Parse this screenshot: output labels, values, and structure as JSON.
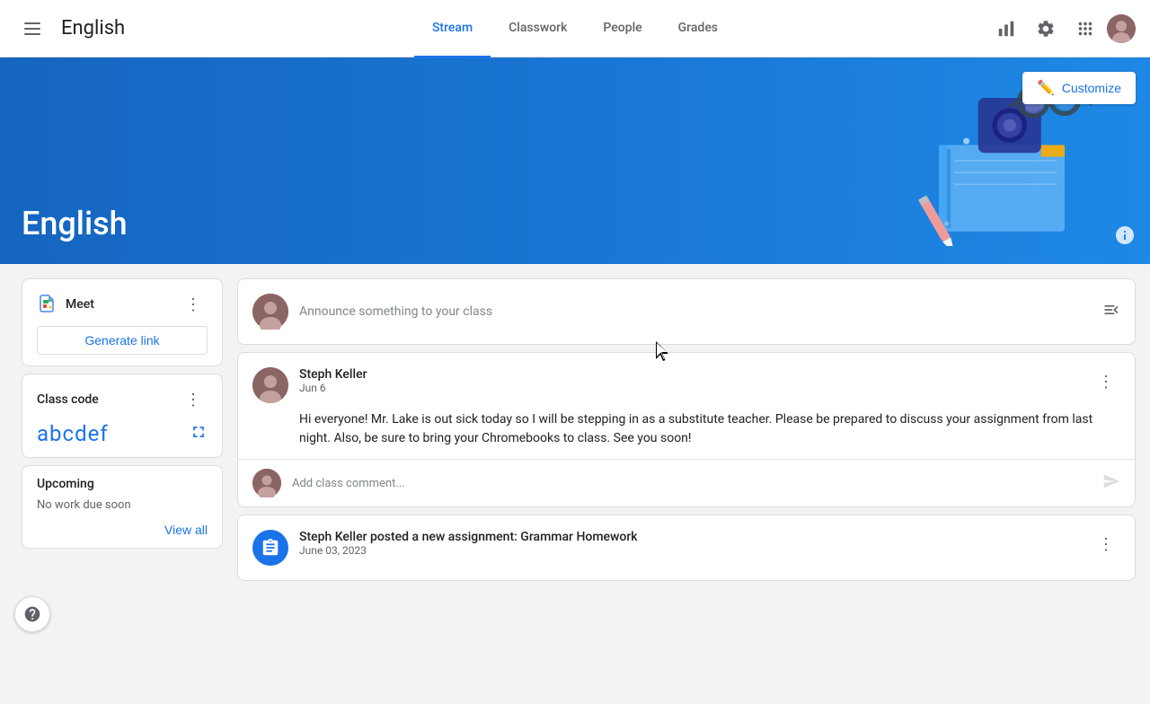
{
  "header": {
    "app_title": "English",
    "hamburger_label": "☰",
    "nav_tabs": [
      {
        "id": "stream",
        "label": "Stream",
        "active": true
      },
      {
        "id": "classwork",
        "label": "Classwork",
        "active": false
      },
      {
        "id": "people",
        "label": "People",
        "active": false
      },
      {
        "id": "grades",
        "label": "Grades",
        "active": false
      }
    ],
    "icons": {
      "analytics": "⊞",
      "settings": "⚙",
      "apps": "⠿"
    }
  },
  "banner": {
    "title": "English",
    "customize_label": "Customize",
    "customize_icon": "✏"
  },
  "sidebar": {
    "meet": {
      "title": "Meet",
      "generate_link_label": "Generate link"
    },
    "class_code": {
      "title": "Class code",
      "value": "abcdef"
    },
    "upcoming": {
      "title": "Upcoming",
      "empty_message": "No work due soon",
      "view_all_label": "View all"
    }
  },
  "stream": {
    "announce_placeholder": "Announce something to your class",
    "posts": [
      {
        "id": "post1",
        "author": "Steph Keller",
        "date": "Jun 6",
        "body": "Hi everyone! Mr. Lake is out sick today so I will be stepping in as a substitute teacher. Please be prepared to discuss your assignment from last night. Also, be sure to bring your Chromebooks to class. See you soon!",
        "comment_placeholder": "Add class comment..."
      }
    ],
    "assignments": [
      {
        "id": "assign1",
        "title": "Steph Keller posted a new assignment: Grammar Homework",
        "date": "June 03, 2023"
      }
    ]
  }
}
